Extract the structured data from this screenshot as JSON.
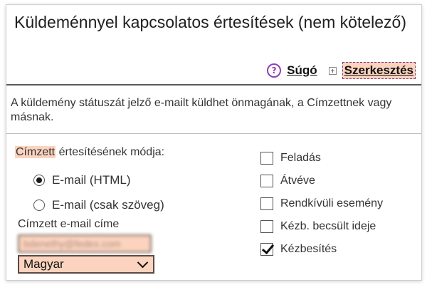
{
  "header": {
    "title": "Küldeménnyel kapcsolatos értesítések (nem kötelező)",
    "help_label": "Súgó",
    "edit_label": "Szerkesztés"
  },
  "description": "A küldemény státuszát jelző e-mailt küldhet önmagának, a Címzettnek vagy másnak.",
  "recipient": {
    "method_label_highlight": "Címzett",
    "method_label_rest": " értesítésének módja:",
    "methods": [
      {
        "label": "E-mail (HTML)",
        "selected": true
      },
      {
        "label": "E-mail (csak szöveg)",
        "selected": false
      }
    ],
    "email_label": "Címzett e-mail címe",
    "email_value": "bdenethy@fedex.com",
    "language_value": "Magyar"
  },
  "events": [
    {
      "label": "Feladás",
      "checked": false
    },
    {
      "label": "Átvéve",
      "checked": false
    },
    {
      "label": "Rendkívüli esemény",
      "checked": false
    },
    {
      "label": "Kézb. becsült ideje",
      "checked": false
    },
    {
      "label": "Kézbesítés",
      "checked": true
    }
  ],
  "colors": {
    "highlight": "#fbd3be",
    "help_icon": "#8e3fb5"
  }
}
